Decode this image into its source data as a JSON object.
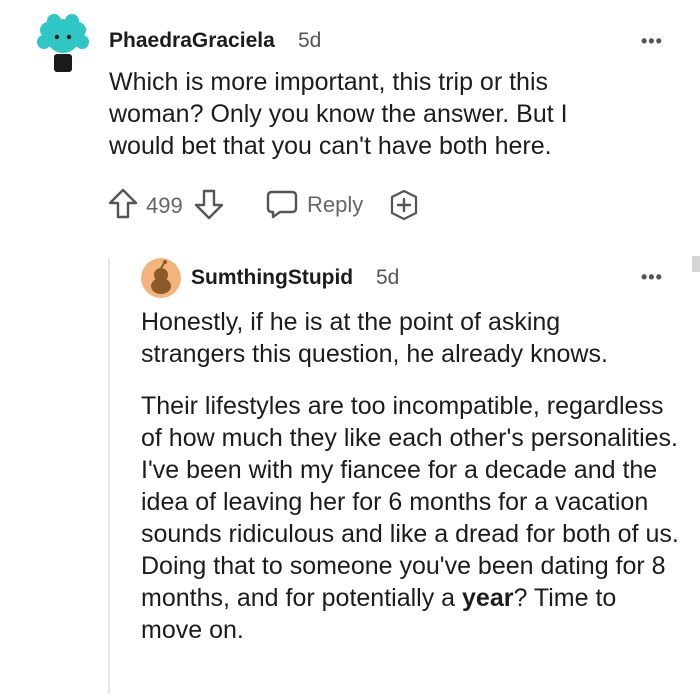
{
  "comment": {
    "username": "PhaedraGraciela",
    "age": "5d",
    "text": "Which is more important, this trip or this woman? Only you know the answer. But I would bet that you can't have both here.",
    "upvote_count": "499",
    "reply_label": "Reply",
    "more_label": "•••"
  },
  "reply": {
    "username": "SumthingStupid",
    "age": "5d",
    "more_label": "•••",
    "paragraph1": "Honestly, if he is at the point of asking strangers this question, he already knows.",
    "paragraph2_before": "Their lifestyles are too incompatible, regardless of how much they like each other's personalities. I've been with my fiancee for a decade and the idea of leaving her for 6 months for a vacation sounds ridiculous and like a dread for both of us. Doing that to someone you've been dating for 8 months, and for potentially a ",
    "paragraph2_bold": "year",
    "paragraph2_after": "? Time to move on."
  },
  "colors": {
    "avatar1_bg": "#2fc6c6",
    "avatar2_bg": "#f3b37a",
    "text": "#1c1c1c",
    "muted": "#666666"
  }
}
